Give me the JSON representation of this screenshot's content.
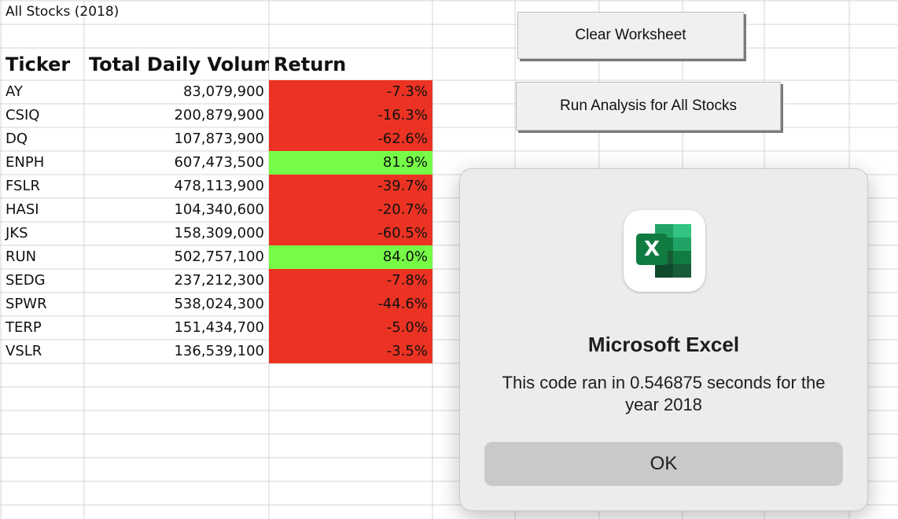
{
  "sheet": {
    "title": "All Stocks (2018)",
    "headers": {
      "ticker": "Ticker",
      "volume": "Total Daily Volume",
      "return": "Return"
    },
    "rows": [
      {
        "ticker": "AY",
        "volume": "83,079,900",
        "return": "-7.3%",
        "status": "negative"
      },
      {
        "ticker": "CSIQ",
        "volume": "200,879,900",
        "return": "-16.3%",
        "status": "negative"
      },
      {
        "ticker": "DQ",
        "volume": "107,873,900",
        "return": "-62.6%",
        "status": "negative"
      },
      {
        "ticker": "ENPH",
        "volume": "607,473,500",
        "return": "81.9%",
        "status": "positive"
      },
      {
        "ticker": "FSLR",
        "volume": "478,113,900",
        "return": "-39.7%",
        "status": "negative"
      },
      {
        "ticker": "HASI",
        "volume": "104,340,600",
        "return": "-20.7%",
        "status": "negative"
      },
      {
        "ticker": "JKS",
        "volume": "158,309,000",
        "return": "-60.5%",
        "status": "negative"
      },
      {
        "ticker": "RUN",
        "volume": "502,757,100",
        "return": "84.0%",
        "status": "positive"
      },
      {
        "ticker": "SEDG",
        "volume": "237,212,300",
        "return": "-7.8%",
        "status": "negative"
      },
      {
        "ticker": "SPWR",
        "volume": "538,024,300",
        "return": "-44.6%",
        "status": "negative"
      },
      {
        "ticker": "TERP",
        "volume": "151,434,700",
        "return": "-5.0%",
        "status": "negative"
      },
      {
        "ticker": "VSLR",
        "volume": "136,539,100",
        "return": "-3.5%",
        "status": "negative"
      }
    ]
  },
  "buttons": {
    "clear": "Clear Worksheet",
    "run": "Run Analysis for All Stocks"
  },
  "dialog": {
    "icon": "excel-app-icon",
    "icon_letter": "X",
    "title": "Microsoft Excel",
    "message": "This code ran in 0.546875 seconds for the year 2018",
    "ok": "OK"
  },
  "colors": {
    "negative_fill": "#ec3323",
    "positive_fill": "#76fb47",
    "excel_green": "#1e7145"
  }
}
